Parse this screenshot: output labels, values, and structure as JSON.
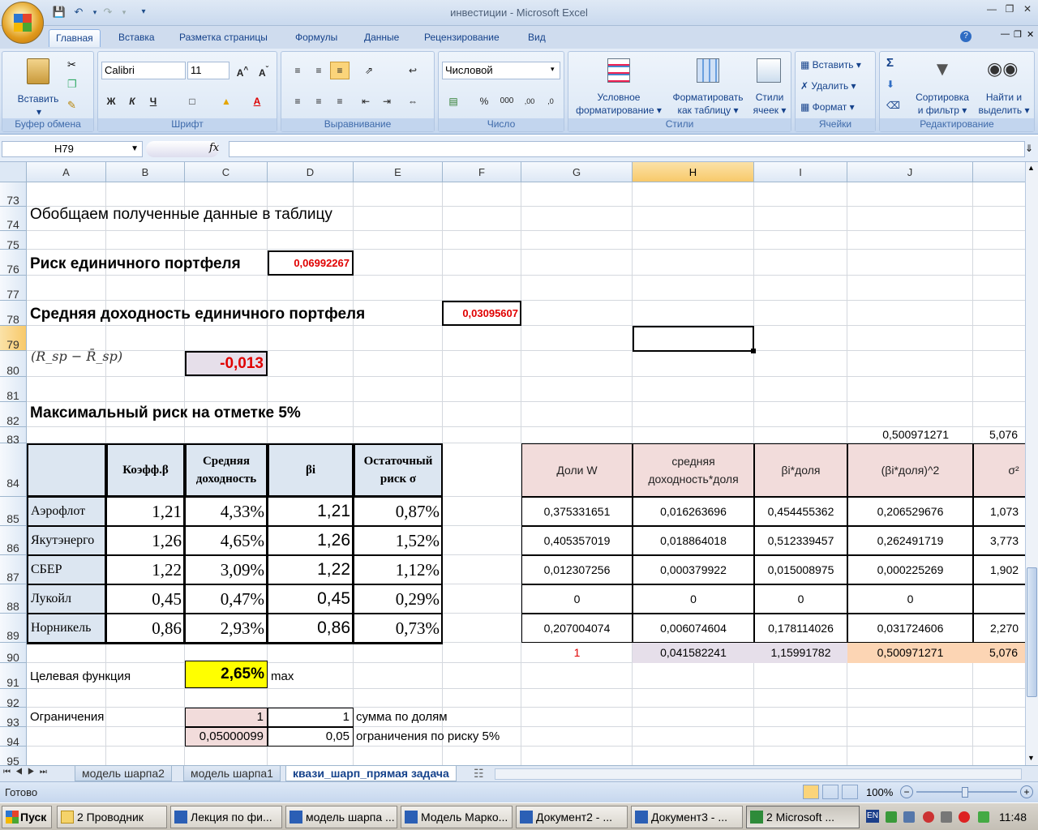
{
  "window": {
    "title": "инвестиции - Microsoft Excel"
  },
  "ribbon": {
    "tabs": [
      "Главная",
      "Вставка",
      "Разметка страницы",
      "Формулы",
      "Данные",
      "Рецензирование",
      "Вид"
    ],
    "clipboard": {
      "paste": "Вставить",
      "label": "Буфер обмена"
    },
    "font": {
      "name": "Calibri",
      "size": "11",
      "bold": "Ж",
      "italic": "К",
      "underline": "Ч",
      "label": "Шрифт"
    },
    "alignment": {
      "label": "Выравнивание"
    },
    "number": {
      "format": "Числовой",
      "percent": "%",
      "thousands": "000",
      "label": "Число"
    },
    "styles": {
      "conditional_line1": "Условное",
      "conditional_line2": "форматирование",
      "table_line1": "Форматировать",
      "table_line2": "как таблицу",
      "cell_line1": "Стили",
      "cell_line2": "ячеек",
      "label": "Стили"
    },
    "cells": {
      "insert": "Вставить",
      "delete": "Удалить",
      "format": "Формат",
      "label": "Ячейки"
    },
    "editing": {
      "sum": "Σ",
      "sort_line1": "Сортировка",
      "sort_line2": "и фильтр",
      "find_line1": "Найти и",
      "find_line2": "выделить",
      "label": "Редактирование"
    }
  },
  "formula_bar": {
    "name_box": "H79",
    "fx": "fx",
    "formula": ""
  },
  "columns": [
    "A",
    "B",
    "C",
    "D",
    "E",
    "F",
    "G",
    "H",
    "I",
    "J"
  ],
  "rows": [
    "73",
    "74",
    "75",
    "76",
    "77",
    "78",
    "79",
    "80",
    "81",
    "82",
    "83",
    "84",
    "85",
    "86",
    "87",
    "88",
    "89",
    "90",
    "91",
    "92",
    "93",
    "94",
    "95"
  ],
  "cells": {
    "A74": "Обобщаем полученные данные в таблицу",
    "A76": "Риск единичного портфеля",
    "D76": "0,06992267",
    "A78": "Средняя доходность единичного портфеля",
    "F78": "0,03095607",
    "C80": "-0,013",
    "A82": "Максимальный риск на отметке 5%",
    "J83": "0,500971271",
    "K83": "5,076",
    "A91": "Целевая функция",
    "C91": "2,65%",
    "D91": "max",
    "A93": "Ограничения",
    "C93": "1",
    "D93": "1",
    "E93": "сумма по долям",
    "C94": "0,05000099",
    "D94": "0,05",
    "E94": "ограничения по риску 5%"
  },
  "formula_image": {
    "text": "(R_sp − R̄_sp)"
  },
  "table1": {
    "headers": [
      "Коэфф.β",
      "Средняя доходность",
      "βi",
      "Остаточный риск σ"
    ],
    "rows": [
      {
        "name": "Аэрофлот",
        "beta": "1,21",
        "ret": "4,33%",
        "bi": "1,21",
        "sigma": "0,87%"
      },
      {
        "name": "Якутэнерго",
        "beta": "1,26",
        "ret": "4,65%",
        "bi": "1,26",
        "sigma": "1,52%"
      },
      {
        "name": "СБЕР",
        "beta": "1,22",
        "ret": "3,09%",
        "bi": "1,22",
        "sigma": "1,12%"
      },
      {
        "name": "Лукойл",
        "beta": "0,45",
        "ret": "0,47%",
        "bi": "0,45",
        "sigma": "0,29%"
      },
      {
        "name": "Норникель",
        "beta": "0,86",
        "ret": "2,93%",
        "bi": "0,86",
        "sigma": "0,73%"
      }
    ]
  },
  "table2": {
    "headers": [
      "Доли W",
      "средняя доходность*доля",
      "βi*доля",
      "(βi*доля)^2",
      "σ²"
    ],
    "rows": [
      [
        "0,375331651",
        "0,016263696",
        "0,454455362",
        "0,206529676",
        "1,073"
      ],
      [
        "0,405357019",
        "0,018864018",
        "0,512339457",
        "0,262491719",
        "3,773"
      ],
      [
        "0,012307256",
        "0,000379922",
        "0,015008975",
        "0,000225269",
        "1,902"
      ],
      [
        "0",
        "0",
        "0",
        "0",
        ""
      ],
      [
        "0,207004074",
        "0,006074604",
        "0,178114026",
        "0,031724606",
        "2,270"
      ]
    ],
    "totals": [
      "1",
      "0,041582241",
      "1,15991782",
      "0,500971271",
      "5,076"
    ]
  },
  "sheets": [
    "модель шарпа2",
    "модель шарпа1",
    "квази_шарп_прямая задача"
  ],
  "status": {
    "ready": "Готово",
    "zoom": "100%"
  },
  "taskbar": {
    "start": "Пуск",
    "items": [
      "2 Проводник",
      "Лекция по фи...",
      "модель шарпа ...",
      "Модель Марко...",
      "Документ2 - ...",
      "Документ3 - ...",
      "2 Microsoft ..."
    ],
    "lang": "EN",
    "clock": "11:48"
  }
}
